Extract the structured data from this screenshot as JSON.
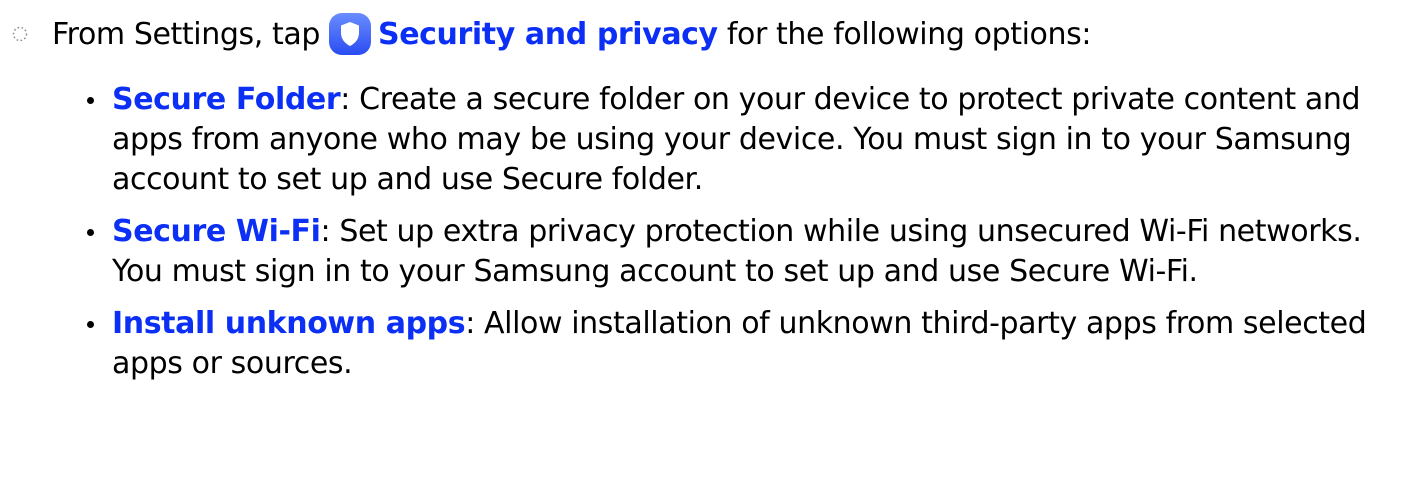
{
  "instruction": {
    "prefix": "From Settings, tap",
    "highlight": "Security and privacy",
    "suffix": "for the following options:",
    "step_icon": "dotted-circle-icon",
    "app_icon": "shield-icon"
  },
  "options": [
    {
      "title": "Secure Folder",
      "description": "Create a secure folder on your device to protect private content and apps from anyone who may be using your device. You must sign in to your Samsung account to set up and use Secure folder."
    },
    {
      "title": "Secure Wi-Fi",
      "description": "Set up extra privacy protection while using unsecured Wi-Fi networks. You must sign in to your Samsung account to set up and use Secure Wi-Fi."
    },
    {
      "title": "Install unknown apps",
      "description": "Allow installation of unknown third-party apps from selected apps or sources."
    }
  ],
  "colors": {
    "accent": "#0b2ff5",
    "icon_gradient_top": "#6a8dff",
    "icon_gradient_bottom": "#2a4cf2",
    "text": "#000000"
  }
}
